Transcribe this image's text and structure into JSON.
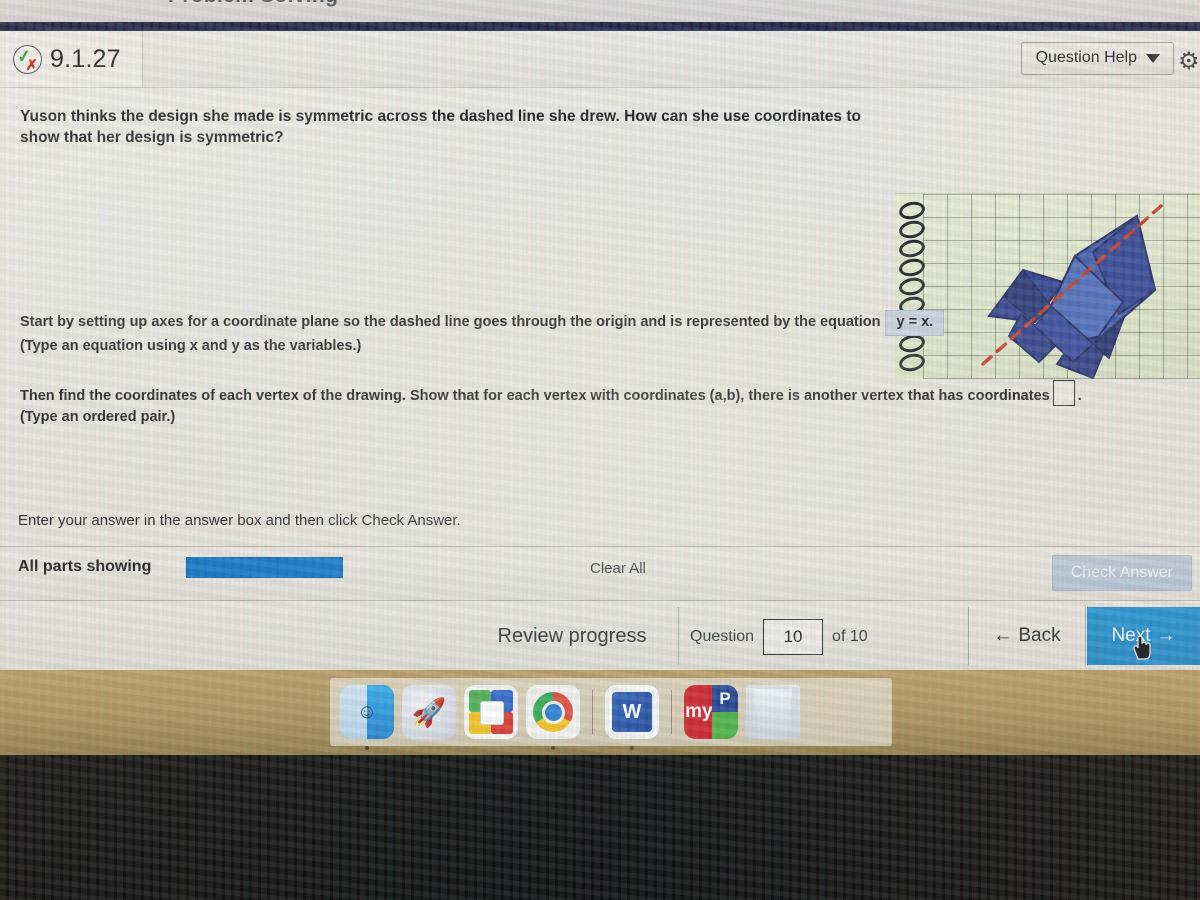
{
  "window": {
    "cut_top_title": "Problem Solving"
  },
  "header": {
    "status_icon": "check-and-x-icon",
    "question_id": "9.1.27",
    "help_label": "Question Help",
    "help_caret": "▼",
    "settings_icon": "gear-icon"
  },
  "question": {
    "stem": "Yuson thinks the design she made is symmetric across the dashed line she drew. How can she use coordinates to show that her design is symmetric?",
    "figure": {
      "name": "spiral-notebook-rocket-graph-photo",
      "description": "Photo of grid graph paper in a spiral notebook with a dark blue rocket drawing and a red dashed diagonal line of symmetry",
      "shape_color": "#2b3a8c",
      "shape_fill_light": "#3d5aa8",
      "dashed_line_color": "#c0392b",
      "paper_color": "#e2e8cf",
      "spiral_color": "#17171a"
    },
    "part1": {
      "text_before": "Start by setting up axes for a coordinate plane so the dashed line goes through the origin and is represented by the equation",
      "answer_value": "y = x.",
      "hint": "(Type an equation using x and y as the variables.)"
    },
    "part2": {
      "text_before": "Then find the coordinates of each vertex of the drawing. Show that for each vertex with coordinates (a,b), there is another vertex that has coordinates",
      "answer_value": "",
      "trailing": ".",
      "hint": "(Type an ordered pair.)"
    }
  },
  "answer_area": {
    "enter_note": "Enter your answer in the answer box and then click Check Answer.",
    "parts_label": "All parts showing",
    "progress_percent": 100,
    "progress_color": "#0a72c4",
    "clear_all_label": "Clear All",
    "check_answer_label": "Check Answer"
  },
  "navbar": {
    "review_label": "Review progress",
    "question_word": "Question",
    "question_number": "10",
    "of_label": "of 10",
    "back_label": "Back",
    "back_icon": "←",
    "next_label": "Next",
    "next_icon": "→",
    "next_accent_color": "#1a8fd0",
    "cursor": "pointing-hand-cursor"
  },
  "dock": {
    "items": [
      {
        "name": "finder-icon",
        "label": "Finder",
        "running": true
      },
      {
        "name": "launchpad-icon",
        "label": "Launchpad",
        "running": false
      },
      {
        "name": "tiles-app-icon",
        "label": "Tiles App",
        "running": false
      },
      {
        "name": "chrome-icon",
        "label": "Google Chrome",
        "running": true
      },
      {
        "name": "word-icon",
        "label": "Microsoft Word",
        "running": true
      },
      {
        "name": "mypasco-connect-icon",
        "label": "myPasco Connect",
        "running": false
      },
      {
        "name": "trash-icon",
        "label": "Trash",
        "running": false
      }
    ],
    "word_glyph": "W",
    "pasco_left_text": "my",
    "pasco_right_text": "P"
  }
}
